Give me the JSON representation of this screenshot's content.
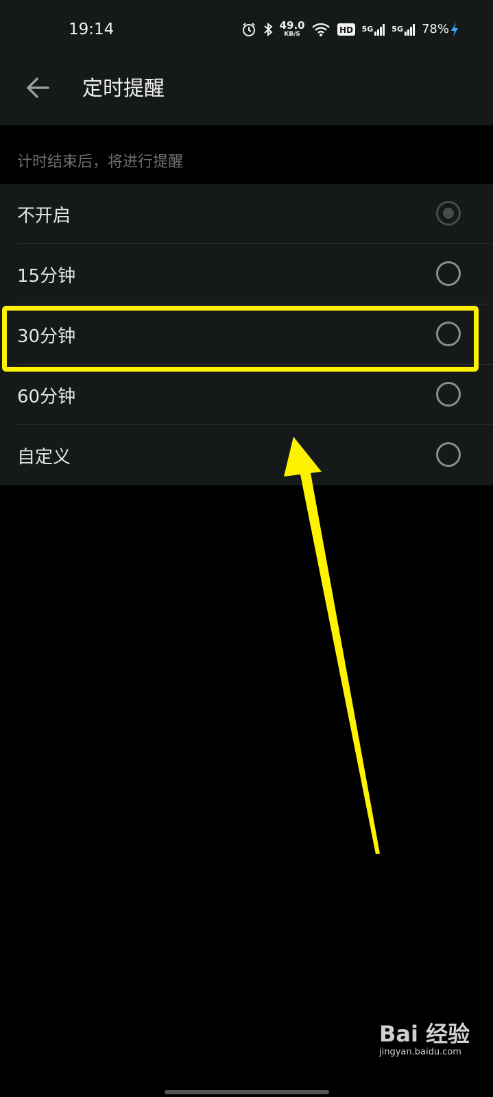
{
  "status_bar": {
    "time": "19:14",
    "net_speed": "49.0",
    "net_unit": "KB/S",
    "hd_badge": "HD",
    "sim1": "5G",
    "sim2": "5G",
    "battery": "78%",
    "icons": [
      "alarm-icon",
      "bluetooth-icon",
      "wifi-icon",
      "signal-icon",
      "charging-icon"
    ]
  },
  "appbar": {
    "title": "定时提醒",
    "back_icon": "back-arrow-icon"
  },
  "hint": "计时结束后，将进行提醒",
  "options": [
    {
      "label": "不开启",
      "selected": true
    },
    {
      "label": "15分钟",
      "selected": false
    },
    {
      "label": "30分钟",
      "selected": false
    },
    {
      "label": "60分钟",
      "selected": false
    },
    {
      "label": "自定义",
      "selected": false
    }
  ],
  "annotation": {
    "color": "#fff200",
    "highlighted_option": "30分钟"
  },
  "watermark": {
    "brand": "Bai 经验",
    "url": "jingyan.baidu.com"
  }
}
